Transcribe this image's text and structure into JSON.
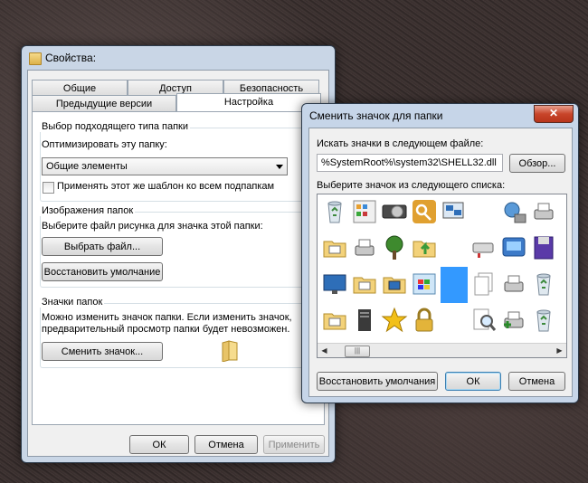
{
  "properties": {
    "title": "Свойства:",
    "tabs_top": [
      "Общие",
      "Доступ",
      "Безопасность"
    ],
    "tabs_bottom": [
      "Предыдущие версии",
      "Настройка"
    ],
    "group1": {
      "label": "Выбор подходящего типа папки",
      "optimize_label": "Оптимизировать эту папку:",
      "combo_value": "Общие элементы",
      "checkbox_label": "Применять этот же шаблон ко всем подпапкам"
    },
    "group2": {
      "label": "Изображения папок",
      "desc": "Выберите файл рисунка для значка этой папки:",
      "choose_button": "Выбрать файл...",
      "restore_button": "Восстановить умолчание"
    },
    "group3": {
      "label": "Значки папок",
      "desc_line1": "Можно изменить значок папки. Если изменить значок,",
      "desc_line2": "предварительный просмотр папки будет невозможен.",
      "change_button": "Сменить значок..."
    },
    "ok": "ОК",
    "cancel": "Отмена",
    "apply": "Применить"
  },
  "change_icon": {
    "title": "Сменить значок для папки",
    "close_glyph": "✕",
    "search_label": "Искать значки в следующем файле:",
    "file_path": "%SystemRoot%\\system32\\SHELL32.dll",
    "browse": "Обзор...",
    "list_label": "Выберите значок из следующего списка:",
    "icons": [
      "recycle-bin-empty-icon",
      "control-panel-icon",
      "disk-drive-icon",
      "key-icon",
      "remote-desktop-icon",
      "blank-icon",
      "network-search-icon",
      "printer-network-icon",
      "folder-printer-icon",
      "printer-folder-icon",
      "tree-icon",
      "folder-up-arrow-icon",
      "blank-icon",
      "network-drive-icon",
      "system-icon",
      "floppy-icon",
      "monitor-icon",
      "folder-font-icon",
      "computer-folder-icon",
      "windows-window-icon",
      "selected-blank-icon",
      "documents-icon",
      "printer-fax-icon",
      "recycle-bin-icon",
      "folder-document-icon",
      "server-icon",
      "star-icon",
      "padlock-icon",
      "blank-icon",
      "magnifier-icon",
      "printer-add-icon",
      "recycle-bin-full-icon"
    ],
    "restore_defaults": "Восстановить умолчания",
    "ok": "ОК",
    "cancel": "Отмена"
  }
}
